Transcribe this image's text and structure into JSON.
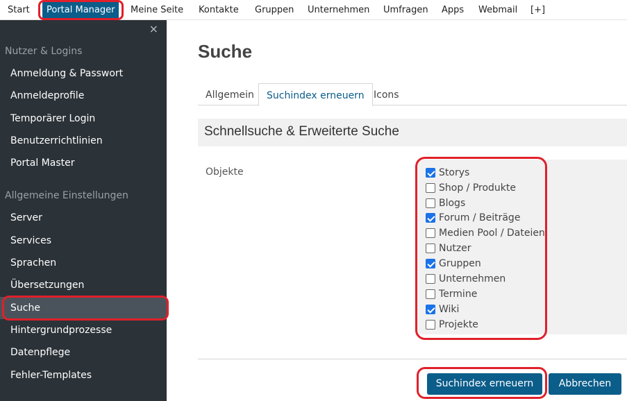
{
  "topnav": {
    "items": [
      "Start",
      "Portal Manager",
      "Meine Seite",
      "Kontakte",
      "Gruppen",
      "Unternehmen",
      "Umfragen",
      "Apps",
      "Webmail",
      "[+]"
    ]
  },
  "sidebar": {
    "close": "×",
    "section1": "Nutzer & Logins",
    "links1": [
      "Anmeldung & Passwort",
      "Anmeldeprofile",
      "Temporärer Login",
      "Benutzerrichtlinien",
      "Portal Master"
    ],
    "section2": "Allgemeine Einstellungen",
    "links2": [
      "Server",
      "Services",
      "Sprachen",
      "Übersetzungen",
      "Suche",
      "Hintergrundprozesse",
      "Datenpflege",
      "Fehler-Templates"
    ],
    "active": "Suche"
  },
  "main": {
    "title": "Suche",
    "tabs": [
      "Allgemein",
      "Suchindex erneuern",
      "Icons"
    ],
    "active_tab": "Suchindex erneuern",
    "panel_title": "Schnellsuche & Erweiterte Suche",
    "objects_label": "Objekte",
    "checkboxes": [
      {
        "label": "Storys",
        "checked": true
      },
      {
        "label": "Shop / Produkte",
        "checked": false
      },
      {
        "label": "Blogs",
        "checked": false
      },
      {
        "label": "Forum / Beiträge",
        "checked": true
      },
      {
        "label": "Medien Pool / Dateien",
        "checked": false
      },
      {
        "label": "Nutzer",
        "checked": false
      },
      {
        "label": "Gruppen",
        "checked": true
      },
      {
        "label": "Unternehmen",
        "checked": false
      },
      {
        "label": "Termine",
        "checked": false
      },
      {
        "label": "Wiki",
        "checked": true
      },
      {
        "label": "Projekte",
        "checked": false
      }
    ],
    "btn_reindex": "Suchindex erneuern",
    "btn_cancel": "Abbrechen"
  },
  "colors": {
    "accent": "#0b5d8a",
    "sidebar": "#2b3238",
    "highlight": "#e0202a",
    "checkbox": "#1a73e8"
  }
}
